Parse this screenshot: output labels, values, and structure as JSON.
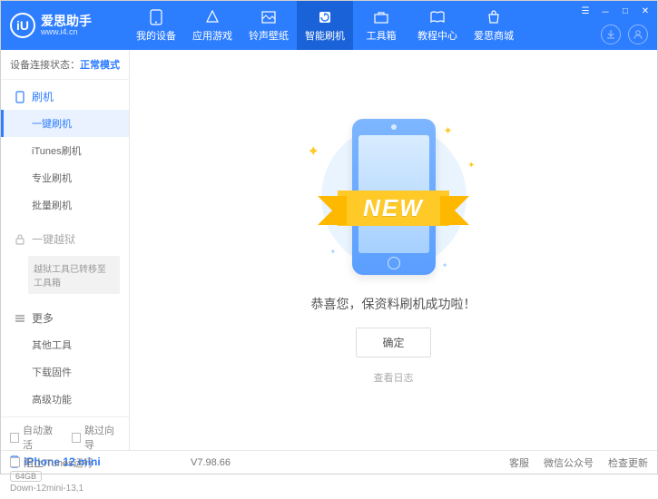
{
  "brand": {
    "title": "爱思助手",
    "url": "www.i4.cn",
    "logo_text": "iU"
  },
  "nav": [
    {
      "label": "我的设备"
    },
    {
      "label": "应用游戏"
    },
    {
      "label": "铃声壁纸"
    },
    {
      "label": "智能刷机"
    },
    {
      "label": "工具箱"
    },
    {
      "label": "教程中心"
    },
    {
      "label": "爱思商城"
    }
  ],
  "status": {
    "prefix": "设备连接状态：",
    "mode": "正常模式"
  },
  "sidebar": {
    "flash": {
      "header": "刷机",
      "items": [
        "一键刷机",
        "iTunes刷机",
        "专业刷机",
        "批量刷机"
      ]
    },
    "jailbreak": {
      "header": "一键越狱",
      "note": "越狱工具已转移至工具箱"
    },
    "more": {
      "header": "更多",
      "items": [
        "其他工具",
        "下载固件",
        "高级功能"
      ]
    }
  },
  "sidebar_bottom": {
    "auto_activate": "自动激活",
    "skip_guide": "跳过向导",
    "device_name": "iPhone 12 mini",
    "storage": "64GB",
    "firmware": "Down-12mini-13,1"
  },
  "content": {
    "ribbon": "NEW",
    "message": "恭喜您，保资料刷机成功啦！",
    "confirm": "确定",
    "view_log": "查看日志"
  },
  "footer": {
    "block_itunes": "阻止iTunes运行",
    "version": "V7.98.66",
    "support": "客服",
    "wechat": "微信公众号",
    "check_update": "检查更新"
  }
}
